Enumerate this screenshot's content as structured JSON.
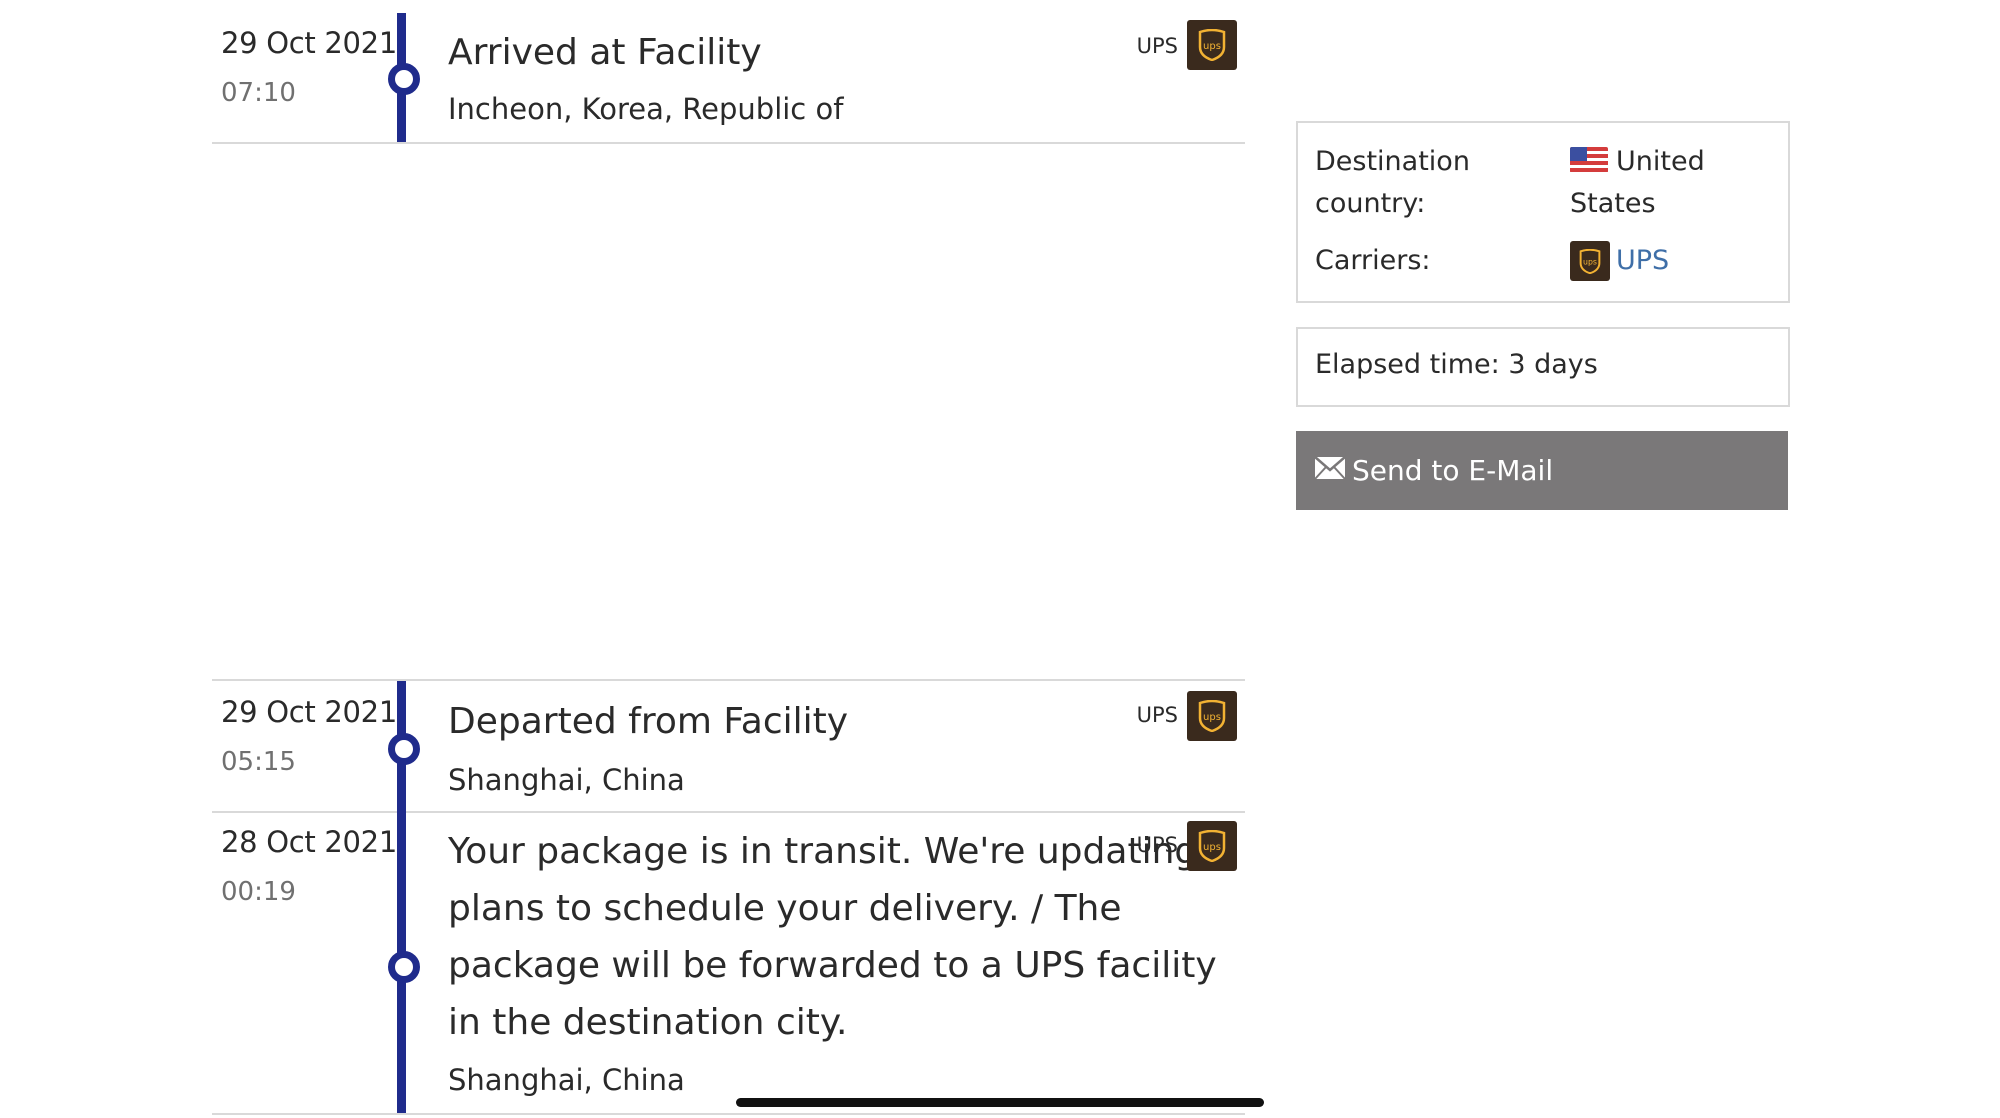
{
  "events": [
    {
      "date": "29 Oct 2021",
      "time": "07:10",
      "status": "Arrived at Facility",
      "location": "Incheon, Korea, Republic of",
      "carrier": "UPS"
    },
    {
      "date": "29 Oct 2021",
      "time": "05:15",
      "status": "Departed from Facility",
      "location": "Shanghai, China",
      "carrier": "UPS"
    },
    {
      "date": "28 Oct 2021",
      "time": "00:19",
      "status": "Your package is in transit. We're updating plans to schedule your delivery. / The package will be forwarded to a UPS facility in the destination city.",
      "location": "Shanghai, China",
      "carrier": "UPS"
    }
  ],
  "info_panel": {
    "destination_label": "Destination country:",
    "destination_value": "United States",
    "carriers_label": "Carriers:",
    "carriers_value": "UPS",
    "carrier_link_color": "#3f6fa8"
  },
  "elapsed": {
    "text": "Elapsed time: 3 days"
  },
  "email_button": {
    "label": "Send to E-Mail",
    "icon": "envelope-icon"
  },
  "colors": {
    "timeline": "#1f2b8c",
    "ups_brown": "#3a2a1d",
    "ups_gold": "#f2b233",
    "button_gray": "#7a7879"
  }
}
